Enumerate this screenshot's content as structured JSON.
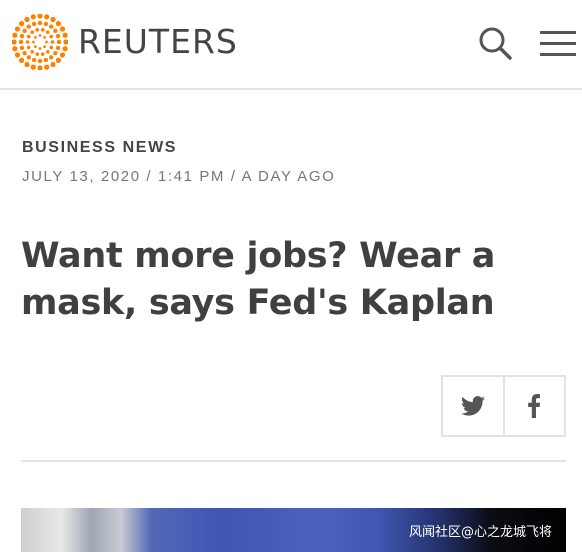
{
  "header": {
    "brand": "REUTERS",
    "accent_color": "#ff8000",
    "search_icon": "search-icon",
    "menu_icon": "hamburger-menu-icon"
  },
  "article": {
    "category": "BUSINESS NEWS",
    "dateline": "JULY 13, 2020 / 1:41 PM / A DAY AGO",
    "headline": "Want more jobs? Wear a mask, says Fed's Kaplan"
  },
  "share": {
    "twitter_icon": "twitter-icon",
    "facebook_icon": "facebook-icon"
  },
  "photo": {
    "watermark": "风闻社区@心之龙城飞将"
  }
}
